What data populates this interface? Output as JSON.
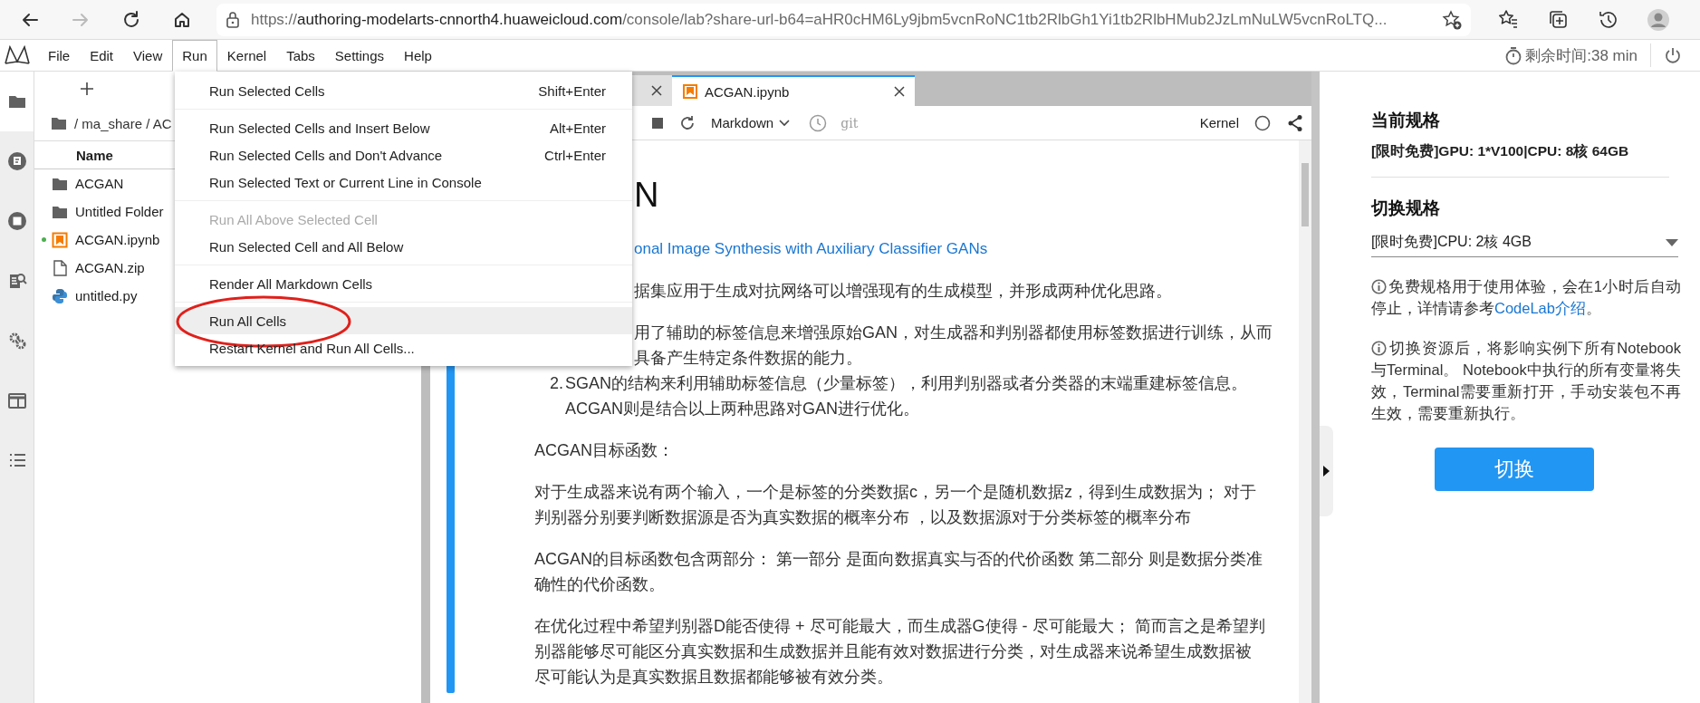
{
  "browser": {
    "nav": [
      {
        "kind": "back",
        "disabled": false
      },
      {
        "kind": "forward",
        "disabled": true
      },
      {
        "kind": "reload",
        "disabled": false
      },
      {
        "kind": "home",
        "disabled": false
      }
    ],
    "url_scheme": "https://",
    "url_host": "authoring-modelarts-cnnorth4.huaweicloud.com",
    "url_path": "/console/lab?share-url-b64=aHR0cHM6Ly9jbm5vcnRoNC1tb2RlbGh1Yi1tb2RlbHMub2JzLmNuLW5vcnRoLTQ...",
    "toolbar": [
      {
        "kind": "favorites"
      },
      {
        "kind": "collections"
      },
      {
        "kind": "history"
      },
      {
        "kind": "profile"
      }
    ]
  },
  "menubar": [
    {
      "label": "File",
      "selected": false
    },
    {
      "label": "Edit",
      "selected": false
    },
    {
      "label": "View",
      "selected": false
    },
    {
      "label": "Run",
      "selected": true
    },
    {
      "label": "Kernel",
      "selected": false
    },
    {
      "label": "Tabs",
      "selected": false
    },
    {
      "label": "Settings",
      "selected": false
    },
    {
      "label": "Help",
      "selected": false
    }
  ],
  "timer": "剩余时间:38 min",
  "activity_bar": [
    {
      "kind": "files",
      "selected": true
    },
    {
      "kind": "running",
      "selected": false
    },
    {
      "kind": "stop",
      "selected": false
    },
    {
      "kind": "inspector",
      "selected": false
    },
    {
      "kind": "extensions",
      "selected": false
    },
    {
      "kind": "tabs",
      "selected": false
    },
    {
      "kind": "toc",
      "selected": false
    }
  ],
  "file_browser": {
    "breadcrumb": "/ ma_share / AC",
    "column": "Name",
    "items": [
      {
        "name": "ACGAN",
        "kind": "folder",
        "running": false
      },
      {
        "name": "Untitled Folder",
        "kind": "folder",
        "running": false
      },
      {
        "name": "ACGAN.ipynb",
        "kind": "notebook",
        "running": true
      },
      {
        "name": "ACGAN.zip",
        "kind": "file",
        "running": false
      },
      {
        "name": "untitled.py",
        "kind": "python",
        "running": false
      }
    ]
  },
  "run_menu": {
    "groups": [
      [
        {
          "label": "Run Selected Cells",
          "shortcut": "Shift+Enter",
          "disabled": false,
          "selected": false,
          "circled": false
        }
      ],
      [
        {
          "label": "Run Selected Cells and Insert Below",
          "shortcut": "Alt+Enter",
          "disabled": false,
          "selected": false,
          "circled": false
        },
        {
          "label": "Run Selected Cells and Don't Advance",
          "shortcut": "Ctrl+Enter",
          "disabled": false,
          "selected": false,
          "circled": false
        },
        {
          "label": "Run Selected Text or Current Line in Console",
          "disabled": false,
          "selected": false,
          "circled": false
        }
      ],
      [
        {
          "label": "Run All Above Selected Cell",
          "disabled": true,
          "selected": false,
          "circled": false
        },
        {
          "label": "Run Selected Cell and All Below",
          "disabled": false,
          "selected": false,
          "circled": false
        }
      ],
      [
        {
          "label": "Render All Markdown Cells",
          "disabled": false,
          "selected": false,
          "circled": false
        }
      ],
      [
        {
          "label": "Run All Cells",
          "disabled": false,
          "selected": true,
          "circled": true
        },
        {
          "label": "Restart Kernel and Run All Cells...",
          "disabled": false,
          "selected": false,
          "circled": false
        }
      ]
    ]
  },
  "notebook": {
    "tabs": [
      {
        "selected": false
      },
      {
        "label": "ACGAN.ipynb",
        "selected": true
      }
    ],
    "cell_type": "Markdown",
    "git": "git",
    "kernel": "Kernel",
    "kernel_busy": false,
    "blocks": [
      {
        "kind": "heading",
        "clipped": true,
        "lines": [
          "N"
        ]
      },
      {
        "kind": "link",
        "clipped": true,
        "lines": [
          "onal Image Synthesis with Auxiliary Classifier GANs"
        ]
      },
      {
        "kind": "paragraph",
        "clipped": true,
        "lines": [
          "据集应用于生成对抗网络可以增强现有的生成模型，并形成两种优化思路。"
        ]
      },
      {
        "kind": "list_item",
        "clipped": true,
        "lines": [
          "用了辅助的标签信息来增强原始GAN，对生成器和判别器都使用标签数据进行训练，从而",
          "具备产生特定条件数据的能力。"
        ]
      },
      {
        "kind": "list_item",
        "clipped": false,
        "number": "2.",
        "lines": [
          "SGAN的结构来利用辅助标签信息（少量标签），利用判别器或者分类器的末端重建标签信息。",
          "ACGAN则是结合以上两种思路对GAN进行优化。"
        ]
      },
      {
        "kind": "paragraph",
        "clipped": false,
        "lines": [
          "ACGAN目标函数："
        ]
      },
      {
        "kind": "paragraph",
        "clipped": false,
        "lines": [
          "对于生成器来说有两个输入，一个是标签的分类数据c，另一个是随机数据z，得到生成数据为； 对于",
          "判别器分别要判断数据源是否为真实数据的概率分布 ，以及数据源对于分类标签的概率分布"
        ]
      },
      {
        "kind": "paragraph",
        "clipped": false,
        "lines": [
          "ACGAN的目标函数包含两部分： 第一部分 是面向数据真实与否的代价函数 第二部分 则是数据分类准",
          "确性的代价函数。"
        ]
      },
      {
        "kind": "paragraph",
        "clipped": false,
        "lines": [
          "在优化过程中希望判别器D能否使得 + 尽可能最大，而生成器G使得 - 尽可能最大； 简而言之是希望判",
          "别器能够尽可能区分真实数据和生成数据并且能有效对数据进行分类，对生成器来说希望生成数据被",
          "尽可能认为是真实数据且数据都能够被有效分类。"
        ]
      }
    ]
  },
  "spec_panel": {
    "current_title": "当前规格",
    "current_spec": "[限时免费]GPU: 1*V100|CPU: 8核 64GB",
    "switch_title": "切换规格",
    "switch_value": "[限时免费]CPU: 2核 4GB",
    "notes": [
      {
        "text": "免费规格用于使用体验，会在1小时后自动停止，详情请参考",
        "link": "CodeLab介绍",
        "after": "。"
      },
      {
        "text": "切换资源后，将影响实例下所有Notebook与Terminal。 Notebook中执行的所有变量将失效，Terminal需要重新打开，手动安装包不再生效，需要重新执行。"
      }
    ],
    "button": "切换"
  }
}
